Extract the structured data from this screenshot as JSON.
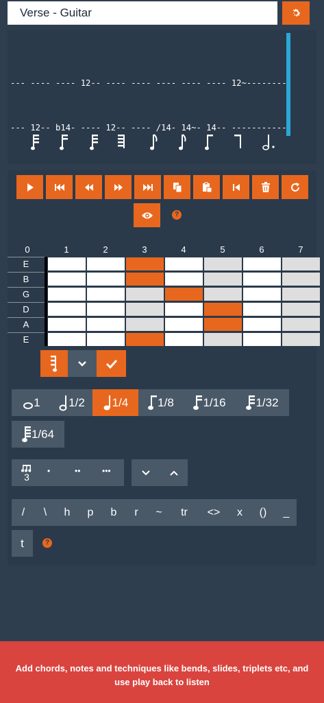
{
  "header": {
    "title_value": "Verse - Guitar",
    "settings_icon": "gear-icon"
  },
  "tab": {
    "lines": [
      "--- ---- ---- 12-- ---- ---- ---- ---- ---- 12~--------",
      "--- 12-- b14- ---- 12-- ---- /14- 14~- 14-- -----------",
      "--- ---- ---- ---- ---- ---- ---- ---- ---- -----------",
      "--- ---- ---- ---- ---- ---- ---- ---- ---- -----------",
      "--- ---- ---- ---- ---- ---- ---- ---- ---- -----------",
      "--- ---- ---- ---- ---- ---- ---- ---- ---- -----------"
    ],
    "note_icons": [
      "thirty-second-note-icon",
      "sixteenth-note-icon",
      "thirty-second-note-icon",
      "thirty-second-rest-icon",
      "eighth-note-icon",
      "eighth-note-icon",
      "eighth-note-icon",
      "eighth-rest-icon",
      "dotted-half-note-icon"
    ],
    "cursor_color": "#2aa8d8"
  },
  "controls": {
    "buttons": [
      {
        "name": "play-button",
        "icon": "play-icon"
      },
      {
        "name": "skip-to-start-button",
        "icon": "skip-start-icon"
      },
      {
        "name": "rewind-button",
        "icon": "rewind-icon"
      },
      {
        "name": "fast-forward-button",
        "icon": "fast-forward-icon"
      },
      {
        "name": "skip-to-end-button",
        "icon": "skip-end-icon"
      },
      {
        "name": "copy-button",
        "icon": "copy-icon"
      },
      {
        "name": "paste-button",
        "icon": "paste-icon"
      },
      {
        "name": "step-back-button",
        "icon": "step-back-icon"
      },
      {
        "name": "delete-button",
        "icon": "trash-icon"
      },
      {
        "name": "refresh-button",
        "icon": "refresh-icon"
      }
    ],
    "view_icon": "eye-icon",
    "help_text": "?"
  },
  "fretboard": {
    "fret_numbers": [
      "0",
      "1",
      "2",
      "3",
      "4",
      "5",
      "6",
      "7"
    ],
    "strings": [
      "E",
      "B",
      "G",
      "D",
      "A",
      "E"
    ],
    "active_cells": [
      [
        0,
        3
      ],
      [
        1,
        3
      ],
      [
        2,
        4
      ],
      [
        3,
        5
      ],
      [
        4,
        5
      ],
      [
        5,
        3
      ]
    ],
    "shaded_frets": [
      3,
      5,
      7
    ],
    "accent_color": "#e8671e"
  },
  "note_actions": {
    "note_icon": "thirty-second-note-icon",
    "chevron_icon": "chevron-down-icon",
    "confirm_icon": "check-icon"
  },
  "durations": {
    "items": [
      {
        "label": "1",
        "icon": "whole-note-icon"
      },
      {
        "label": "1/2",
        "icon": "half-note-icon"
      },
      {
        "label": "1/4",
        "icon": "quarter-note-icon",
        "active": true
      },
      {
        "label": "1/8",
        "icon": "eighth-note-icon"
      },
      {
        "label": "1/16",
        "icon": "sixteenth-note-icon"
      },
      {
        "label": "1/32",
        "icon": "thirty-second-note-icon"
      },
      {
        "label": "1/64",
        "icon": "sixty-fourth-note-icon"
      }
    ]
  },
  "modifiers": {
    "triplet_label": "3",
    "dot_single": "•",
    "dot_double": "••",
    "dot_triple": "•••"
  },
  "techniques": {
    "items": [
      "/",
      "\\",
      "h",
      "p",
      "b",
      "r",
      "~",
      "tr",
      "<>",
      "x",
      "()",
      "_"
    ],
    "extra": "t",
    "help_text": "?"
  },
  "footer": {
    "message": "Add chords, notes and techniques like bends, slides, triplets etc, and use play back to listen"
  }
}
